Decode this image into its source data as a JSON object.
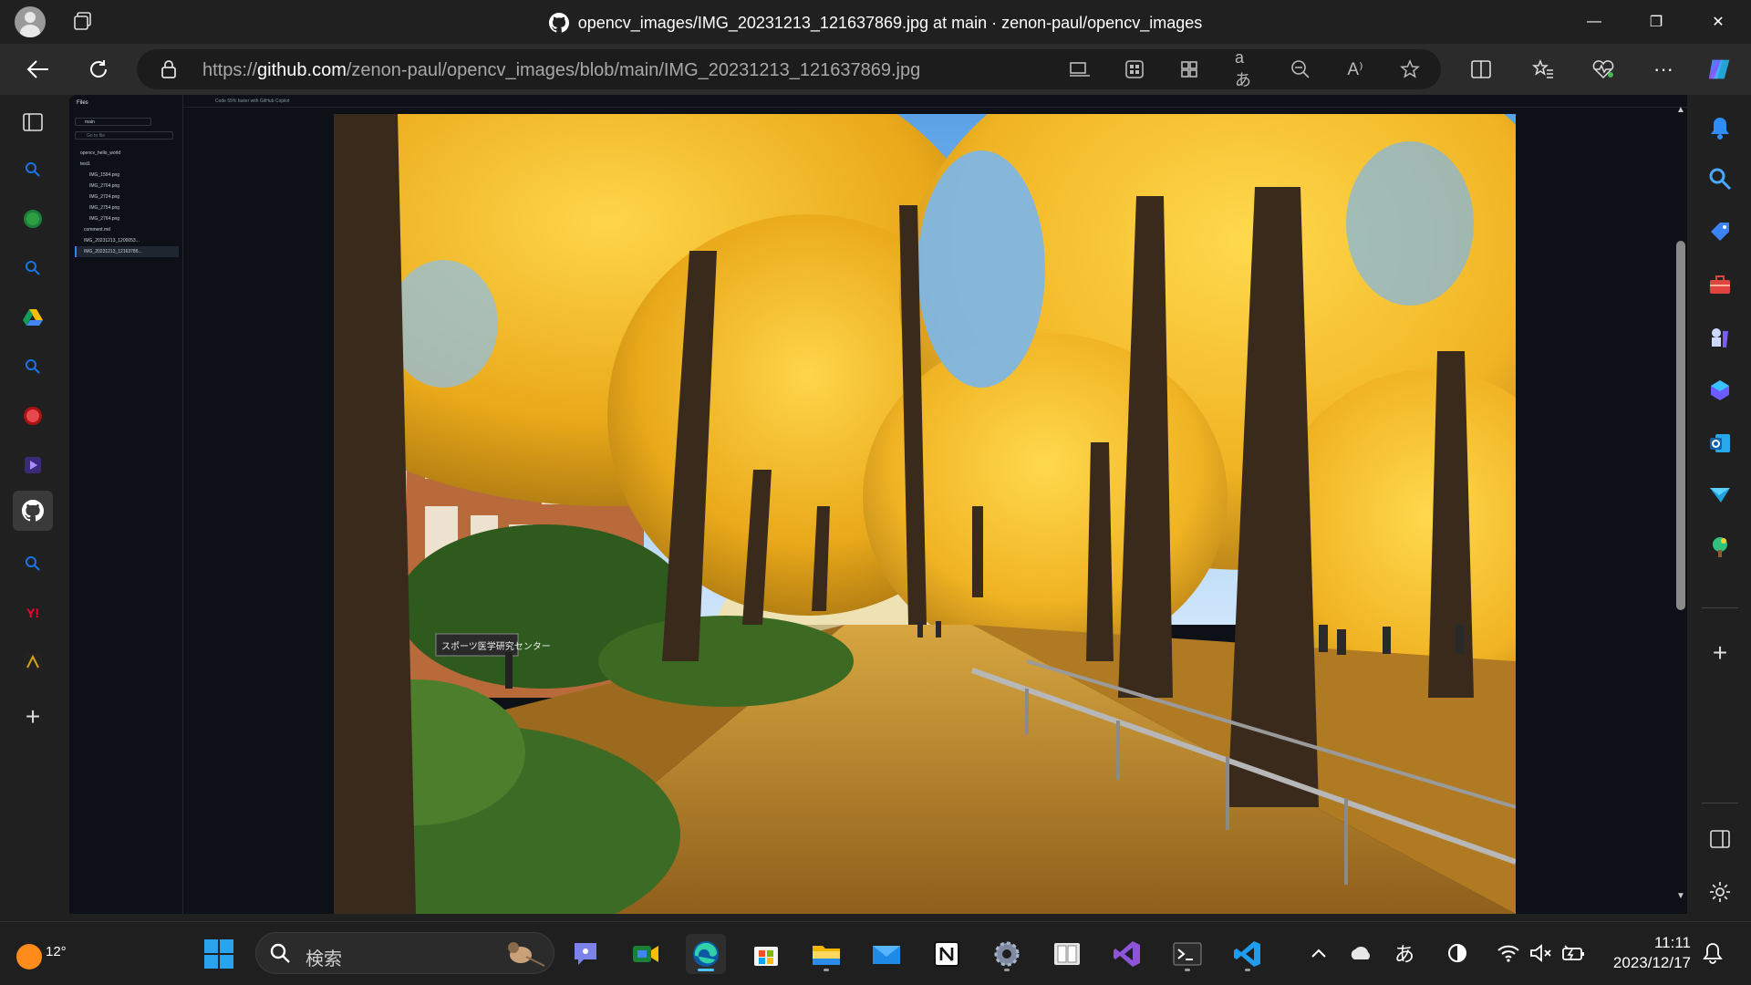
{
  "window": {
    "title": "opencv_images/IMG_20231213_121637869.jpg at main · zenon-paul/opencv_images",
    "minimize_symbol": "—",
    "maximize_symbol": "❐",
    "close_symbol": "✕"
  },
  "address_bar": {
    "url_prefix": "https://",
    "url_domain": "github.com",
    "url_path": "/zenon-paul/opencv_images/blob/main/IMG_20231213_121637869.jpg"
  },
  "left_strip": {
    "items": [
      {
        "name": "tab-actions",
        "color": "#cccccc"
      },
      {
        "name": "search-tab",
        "color": "#1a73e8"
      },
      {
        "name": "green-app-tab",
        "color": "#2ea043"
      },
      {
        "name": "search-tab-2",
        "color": "#1a73e8"
      },
      {
        "name": "google-drive-tab",
        "color": "#fbbc04"
      },
      {
        "name": "search-tab-3",
        "color": "#1a73e8"
      },
      {
        "name": "red-app-tab",
        "color": "#e5484d"
      },
      {
        "name": "purple-app-tab",
        "color": "#6e40c9"
      },
      {
        "name": "github-tab",
        "color": "#ffffff"
      },
      {
        "name": "search-tab-4",
        "color": "#1a73e8"
      },
      {
        "name": "yahoo-tab",
        "color": "#ff0033"
      },
      {
        "name": "atcoder-tab",
        "color": "#d4a017"
      }
    ],
    "add_symbol": "+"
  },
  "github": {
    "files_title": "Files",
    "branch": "main",
    "go_to_file": "Go to file",
    "copilot_banner": "Code 55% faster with GitHub Copilot",
    "tree": [
      {
        "label": "opencv_hello_world",
        "type": "folder"
      },
      {
        "label": "test1",
        "type": "folder"
      },
      {
        "label": "IMG_1594.png",
        "type": "file"
      },
      {
        "label": "IMG_2704.png",
        "type": "file"
      },
      {
        "label": "IMG_2724.png",
        "type": "file"
      },
      {
        "label": "IMG_2754.png",
        "type": "file"
      },
      {
        "label": "IMG_2764.png",
        "type": "file"
      },
      {
        "label": "comment.md",
        "type": "file"
      },
      {
        "label": "IMG_20231213_1200053...",
        "type": "file"
      },
      {
        "label": "IMG_20231213_12163786...",
        "type": "file",
        "selected": true
      }
    ]
  },
  "image": {
    "sign_text": "スポーツ医学研究センター"
  },
  "taskbar": {
    "weather_temp": "12°",
    "search_placeholder": "検索",
    "ime_label": "あ",
    "time": "11:11",
    "date": "2023/12/17"
  },
  "colors": {
    "accent": "#4cc2ff",
    "github_bg": "#0d1117",
    "chrome_bg": "#202020"
  }
}
